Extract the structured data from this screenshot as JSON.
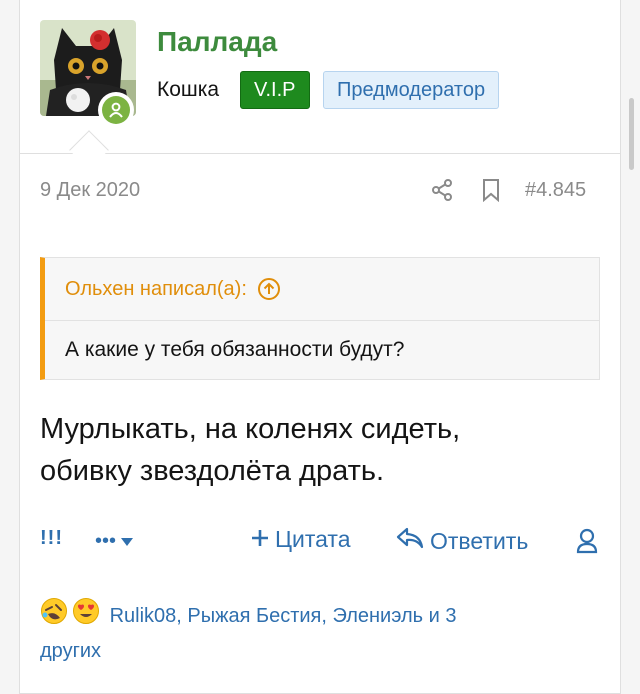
{
  "post": {
    "username": "Паллада",
    "user_title": "Кошка",
    "badges": {
      "vip": "V.I.P",
      "moderator": "Предмодератор"
    },
    "date": "9 Дек 2020",
    "post_number": "#4.845",
    "quote": {
      "author": "Ольхен написал(а):",
      "text": "А какие у тебя обязанности будут?"
    },
    "message_line1": "Мурлыкать, на коленях сидеть,",
    "message_line2": "обивку звездолёта драть."
  },
  "actions": {
    "react": "!!!",
    "more": "•••",
    "quote": "Цитата",
    "reply": "Ответить"
  },
  "reactions": {
    "text_line1": "Rulik08, Рыжая Бестия, Элениэль и 3",
    "text_line2": "других",
    "emoji": [
      "rofl-emoji",
      "heart-eyes-emoji"
    ]
  },
  "colors": {
    "username": "#3d8b3d",
    "vip_badge": "#1e8a1e",
    "mod_badge_bg": "#e3f0fb",
    "link": "#2f6fae",
    "quote_accent": "#f39c12",
    "online": "#7cb342"
  }
}
